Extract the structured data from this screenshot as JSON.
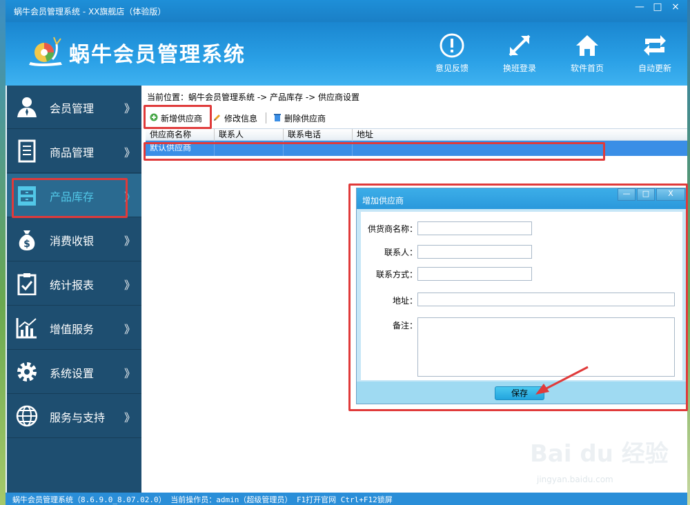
{
  "window": {
    "title": "蜗牛会员管理系统 - XX旗舰店（体验版）",
    "controls": [
      "—",
      "□",
      "×"
    ]
  },
  "header": {
    "brand": "蜗牛会员管理系统",
    "tools": [
      {
        "label": "意见反馈",
        "icon": "feedback-icon"
      },
      {
        "label": "换班登录",
        "icon": "swap-login-icon"
      },
      {
        "label": "软件首页",
        "icon": "home-icon"
      },
      {
        "label": "自动更新",
        "icon": "refresh-icon"
      }
    ]
  },
  "sidebar": {
    "items": [
      {
        "label": "会员管理",
        "icon": "member-icon",
        "chevron": "》"
      },
      {
        "label": "商品管理",
        "icon": "document-icon",
        "chevron": "》"
      },
      {
        "label": "产品库存",
        "icon": "cabinet-icon",
        "chevron": "》",
        "active": true
      },
      {
        "label": "消费收银",
        "icon": "money-bag-icon",
        "chevron": "》"
      },
      {
        "label": "统计报表",
        "icon": "clipboard-icon",
        "chevron": "》"
      },
      {
        "label": "增值服务",
        "icon": "chart-icon",
        "chevron": "》"
      },
      {
        "label": "系统设置",
        "icon": "gear-icon",
        "chevron": "》"
      },
      {
        "label": "服务与支持",
        "icon": "globe-icon",
        "chevron": "》"
      }
    ]
  },
  "main": {
    "breadcrumb": "当前位置：蜗牛会员管理系统 -> 产品库存 -> 供应商设置",
    "toolbar": {
      "add": "新增供应商",
      "edit": "修改信息",
      "delete": "删除供应商"
    },
    "table": {
      "columns": [
        "供应商名称",
        "联系人",
        "联系电话",
        "地址"
      ],
      "rows": [
        [
          "默认供应商",
          "",
          "",
          ""
        ]
      ]
    }
  },
  "dialog": {
    "title": "增加供应商",
    "controls": [
      "—",
      "□",
      "X"
    ],
    "fields": {
      "name_label": "供货商名称：",
      "name_value": "",
      "contact_label": "联系人：",
      "contact_value": "",
      "phone_label": "联系方式：",
      "phone_value": "",
      "address_label": "地址：",
      "address_value": "",
      "note_label": "备注：",
      "note_value": ""
    },
    "save_label": "保存"
  },
  "statusbar": {
    "text": "蜗牛会员管理系统（8.6.9.0_8.07.02.0） 当前操作员：admin（超级管理员） F1打开官网 Ctrl+F12锁屏"
  },
  "watermark": {
    "logo_text": "Bai du 经验",
    "url": "jingyan.baidu.com"
  },
  "colors": {
    "header": "#2aa0e6",
    "sidebar": "#1e4e70",
    "active_text": "#52c8e8",
    "selected_row": "#3a8ee6",
    "highlight": "#e03a3a"
  }
}
